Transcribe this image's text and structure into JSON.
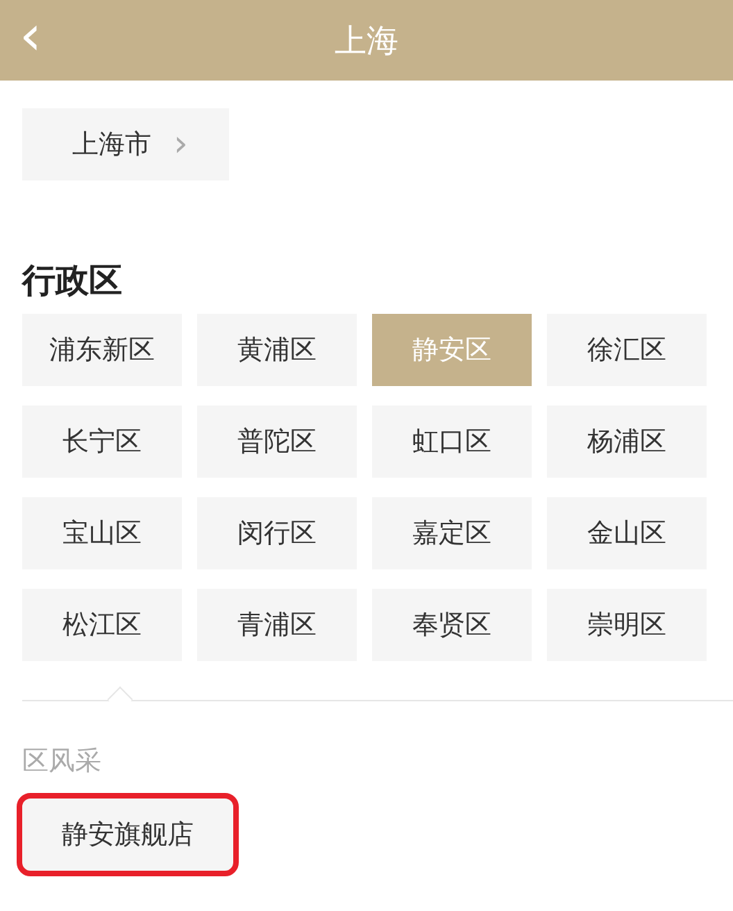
{
  "header": {
    "back_icon": "‹",
    "title": "上海"
  },
  "city_button": {
    "label": "上海市",
    "chevron": "›"
  },
  "districts": {
    "title": "行政区",
    "items": [
      {
        "label": "浦东新区",
        "selected": false
      },
      {
        "label": "黄浦区",
        "selected": false
      },
      {
        "label": "静安区",
        "selected": true
      },
      {
        "label": "徐汇区",
        "selected": false
      },
      {
        "label": "长宁区",
        "selected": false
      },
      {
        "label": "普陀区",
        "selected": false
      },
      {
        "label": "虹口区",
        "selected": false
      },
      {
        "label": "杨浦区",
        "selected": false
      },
      {
        "label": "宝山区",
        "selected": false
      },
      {
        "label": "闵行区",
        "selected": false
      },
      {
        "label": "嘉定区",
        "selected": false
      },
      {
        "label": "金山区",
        "selected": false
      },
      {
        "label": "松江区",
        "selected": false
      },
      {
        "label": "青浦区",
        "selected": false
      },
      {
        "label": "奉贤区",
        "selected": false
      },
      {
        "label": "崇明区",
        "selected": false
      }
    ]
  },
  "showcase": {
    "title": "区风采",
    "items": [
      {
        "label": "静安旗舰店",
        "highlighted": true
      }
    ]
  }
}
